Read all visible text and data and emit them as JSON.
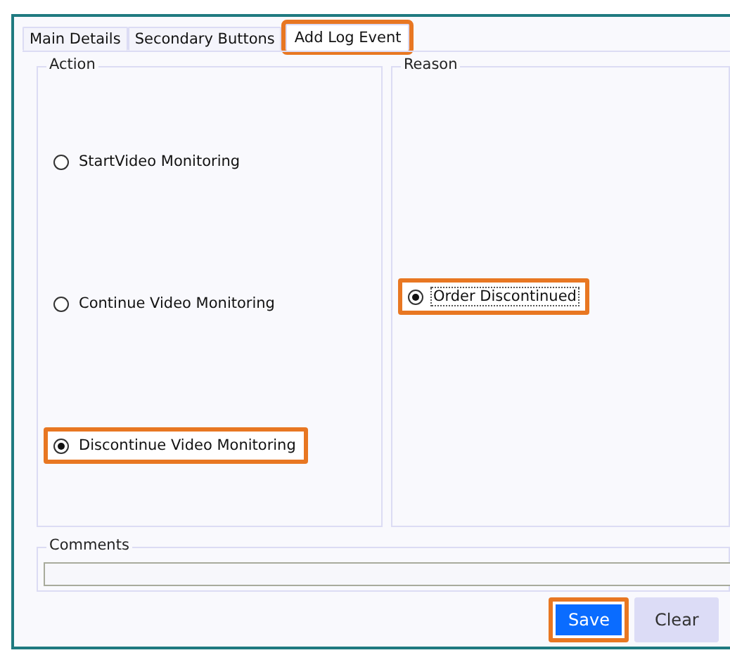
{
  "tabs": [
    {
      "label": "Main Details",
      "selected": false,
      "highlighted": false
    },
    {
      "label": "Secondary Buttons",
      "selected": false,
      "highlighted": false
    },
    {
      "label": "Add Log Event",
      "selected": true,
      "highlighted": true
    }
  ],
  "action": {
    "title": "Action",
    "options": [
      {
        "label": "StartVideo Monitoring",
        "selected": false,
        "highlighted": false
      },
      {
        "label": "Continue Video Monitoring",
        "selected": false,
        "highlighted": false
      },
      {
        "label": "Discontinue Video Monitoring",
        "selected": true,
        "highlighted": true
      }
    ]
  },
  "reason": {
    "title": "Reason",
    "options": [
      {
        "label": "Order Discontinued",
        "selected": true,
        "highlighted": true
      }
    ]
  },
  "comments": {
    "title": "Comments"
  },
  "buttons": [
    {
      "label": "Save",
      "kind": "primary",
      "highlighted": true
    },
    {
      "label": "Clear",
      "kind": "secondary",
      "highlighted": false
    }
  ]
}
